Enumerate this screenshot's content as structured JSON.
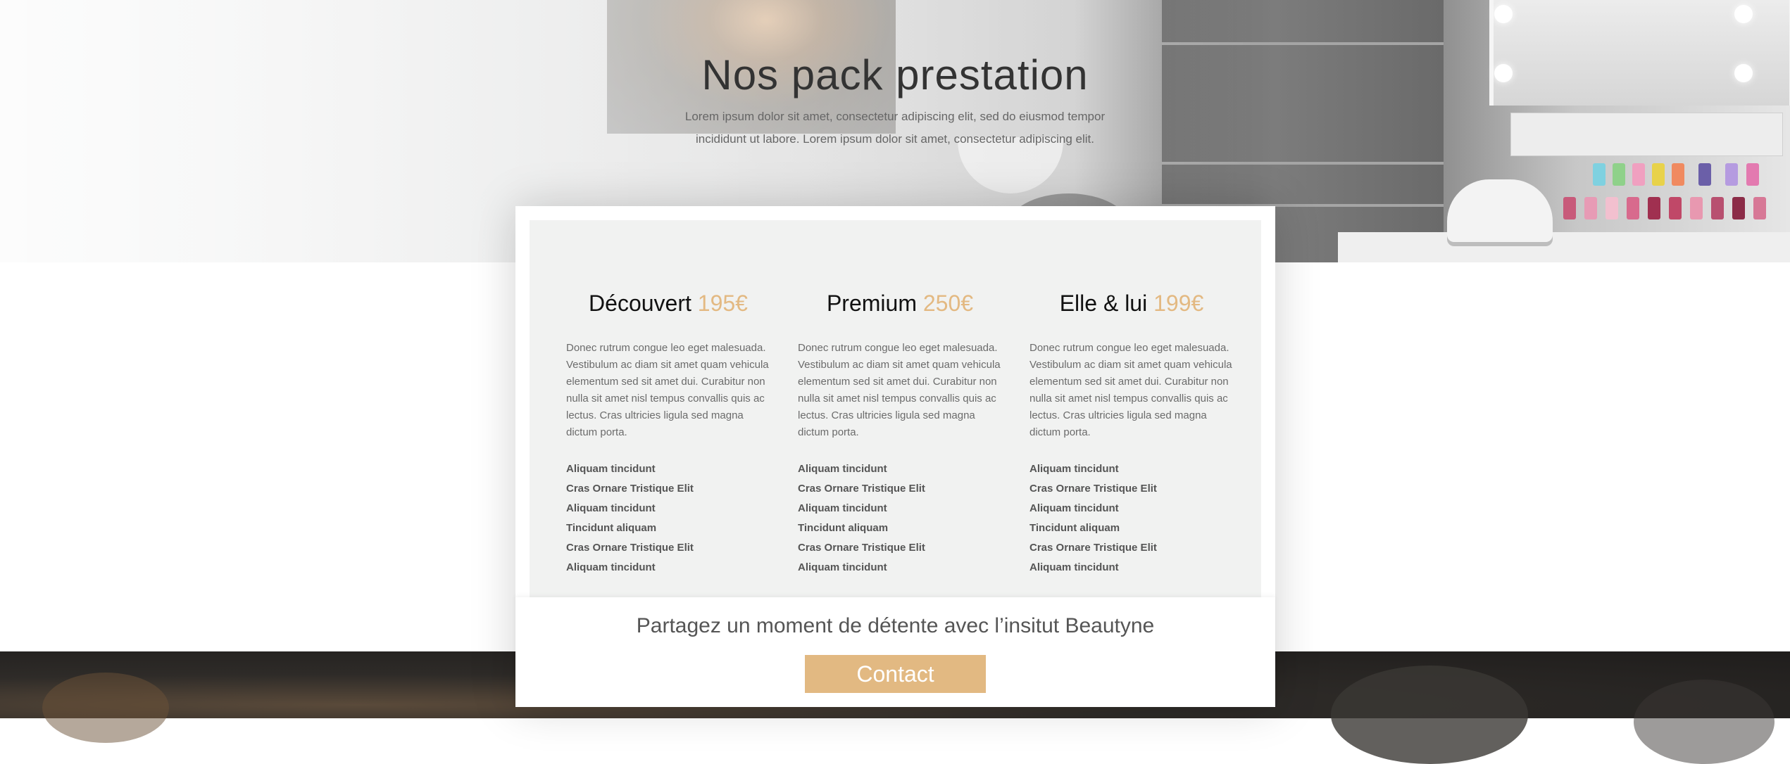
{
  "hero": {
    "title": "Nos pack prestation",
    "subtitle": "Lorem ipsum dolor sit amet, consectetur adipiscing elit, sed do eiusmod tempor incididunt ut labore. Lorem ipsum dolor sit amet, consectetur adipiscing elit."
  },
  "packs": [
    {
      "name": "Découvert",
      "price": "195€",
      "description": "Donec rutrum congue leo eget malesuada. Vestibulum ac diam sit amet quam vehicula elementum sed sit amet dui. Curabitur non nulla sit amet nisl tempus convallis quis ac lectus. Cras ultricies ligula sed magna dictum porta.",
      "features": [
        "Aliquam tincidunt",
        "Cras Ornare Tristique Elit",
        "Aliquam tincidunt",
        "Tincidunt aliquam",
        "Cras Ornare Tristique Elit",
        "Aliquam tincidunt"
      ]
    },
    {
      "name": "Premium",
      "price": "250€",
      "description": "Donec rutrum congue leo eget malesuada. Vestibulum ac diam sit amet quam vehicula elementum sed sit amet dui. Curabitur non nulla sit amet nisl tempus convallis quis ac lectus. Cras ultricies ligula sed magna dictum porta.",
      "features": [
        "Aliquam tincidunt",
        "Cras Ornare Tristique Elit",
        "Aliquam tincidunt",
        "Tincidunt aliquam",
        "Cras Ornare Tristique Elit",
        "Aliquam tincidunt"
      ]
    },
    {
      "name": "Elle & lui",
      "price": "199€",
      "description": "Donec rutrum congue leo eget malesuada. Vestibulum ac diam sit amet quam vehicula elementum sed sit amet dui. Curabitur non nulla sit amet nisl tempus convallis quis ac lectus. Cras ultricies ligula sed magna dictum porta.",
      "features": [
        "Aliquam tincidunt",
        "Cras Ornare Tristique Elit",
        "Aliquam tincidunt",
        "Tincidunt aliquam",
        "Cras Ornare Tristique Elit",
        "Aliquam tincidunt"
      ]
    }
  ],
  "cta": {
    "text": "Partagez un moment de détente avec l’insitut Beautyne",
    "button_label": "Contact"
  },
  "colors": {
    "accent": "#e2b982",
    "price": "#e3b982",
    "card_background": "#f1f2f1",
    "band": "#2a2826"
  }
}
